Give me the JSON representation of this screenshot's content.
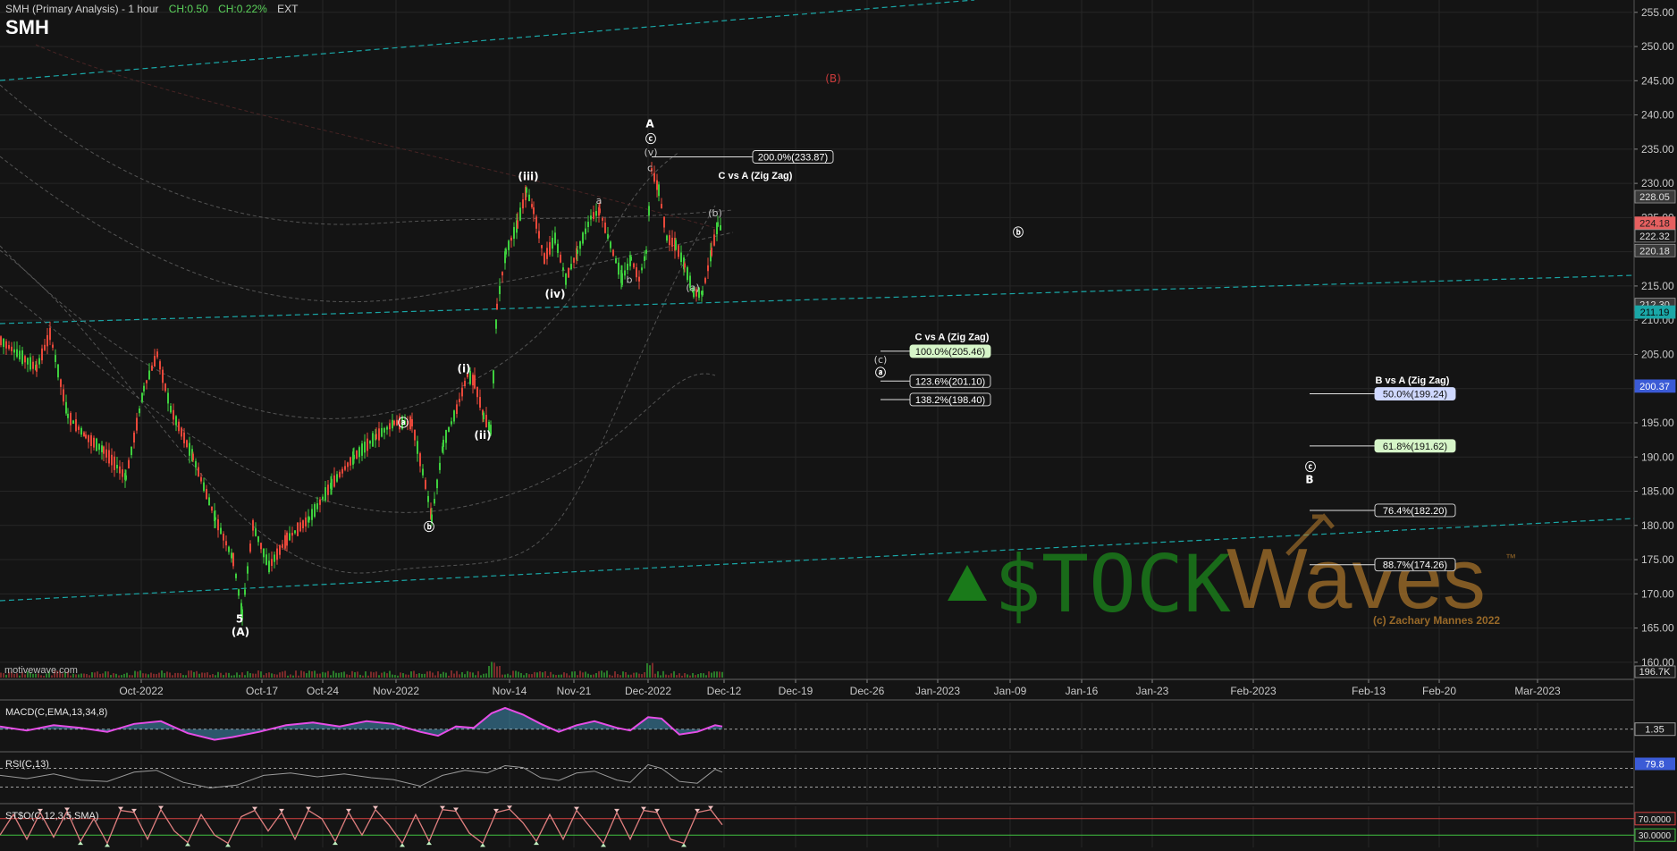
{
  "header": {
    "title": "SMH (Primary Analysis) - 1 hour",
    "change_abs": "CH:0.50",
    "change_pct": "CH:0.22%",
    "ext": "EXT",
    "symbol": "SMH"
  },
  "footer_text": "motivewave.com",
  "colors": {
    "background": "#141414",
    "grid": "#262626",
    "up": "#3ecf3e",
    "down": "#e8483a",
    "channel": "#1aa7a7",
    "macd": "#e64de6",
    "macd_hist": "#4aa9d8",
    "brand_green": "#1a7a1a",
    "brand_gold": "#b0782c"
  },
  "chart_data": {
    "type": "line",
    "price_axis": {
      "ticks": [
        160,
        165,
        170,
        175,
        180,
        185,
        190,
        195,
        200,
        205,
        210,
        215,
        220,
        225,
        230,
        235,
        240,
        245,
        250,
        255
      ],
      "ylim": [
        157.5,
        256.8
      ]
    },
    "date_axis": {
      "ticks": [
        "Oct-2022",
        "Oct-17",
        "Oct-24",
        "Nov-2022",
        "Nov-14",
        "Nov-21",
        "Dec-2022",
        "Dec-12",
        "Dec-19",
        "Dec-26",
        "Jan-2023",
        "Jan-09",
        "Jan-16",
        "Jan-23",
        "Feb-2023",
        "Feb-13",
        "Feb-20",
        "Mar-2023"
      ]
    },
    "price_tags": [
      {
        "value": "228.05",
        "price": 228.05,
        "style": "grey"
      },
      {
        "value": "224.18",
        "price": 224.18,
        "style": "red"
      },
      {
        "value": "222.32",
        "price": 222.32,
        "style": "dark"
      },
      {
        "value": "220.18",
        "price": 220.18,
        "style": "grey"
      },
      {
        "value": "212.30",
        "price": 212.3,
        "style": "grey"
      },
      {
        "value": "211.19",
        "price": 211.19,
        "style": "teal"
      },
      {
        "value": "200.37",
        "price": 200.37,
        "style": "blue"
      }
    ],
    "volume_tag": "196.7K",
    "price_series": [
      [
        0,
        207
      ],
      [
        40,
        203
      ],
      [
        55,
        208
      ],
      [
        75,
        196
      ],
      [
        95,
        193
      ],
      [
        115,
        191
      ],
      [
        140,
        187
      ],
      [
        160,
        200
      ],
      [
        175,
        205
      ],
      [
        190,
        197
      ],
      [
        215,
        190
      ],
      [
        240,
        181
      ],
      [
        260,
        175
      ],
      [
        270,
        167
      ],
      [
        282,
        180
      ],
      [
        300,
        174
      ],
      [
        320,
        178
      ],
      [
        345,
        181
      ],
      [
        370,
        186
      ],
      [
        395,
        190
      ],
      [
        420,
        193
      ],
      [
        440,
        195
      ],
      [
        460,
        195
      ],
      [
        475,
        186
      ],
      [
        482,
        181
      ],
      [
        495,
        192
      ],
      [
        510,
        197
      ],
      [
        522,
        202
      ],
      [
        530,
        201
      ],
      [
        540,
        196
      ],
      [
        548,
        194
      ],
      [
        555,
        212
      ],
      [
        565,
        220
      ],
      [
        578,
        224
      ],
      [
        588,
        229
      ],
      [
        596,
        226
      ],
      [
        608,
        219
      ],
      [
        620,
        222
      ],
      [
        632,
        216
      ],
      [
        645,
        220
      ],
      [
        660,
        225
      ],
      [
        670,
        226
      ],
      [
        682,
        221
      ],
      [
        695,
        216
      ],
      [
        705,
        219
      ],
      [
        714,
        216
      ],
      [
        722,
        220
      ],
      [
        728,
        232
      ],
      [
        736,
        229
      ],
      [
        745,
        222
      ],
      [
        755,
        221
      ],
      [
        765,
        218
      ],
      [
        775,
        214
      ],
      [
        785,
        214
      ],
      [
        795,
        220
      ],
      [
        802,
        224
      ],
      [
        808,
        223
      ]
    ],
    "wave_labels": [
      {
        "text": "5",
        "x": 268,
        "price": 166.3,
        "type": "plain"
      },
      {
        "text": "(A)",
        "x": 269,
        "price": 164.4,
        "type": "plain"
      },
      {
        "text": "ⓑ",
        "x": 480,
        "price": 179.8,
        "type": "plain"
      },
      {
        "text": "ⓐ",
        "x": 451,
        "price": 195.0,
        "type": "plain"
      },
      {
        "text": "(i)",
        "x": 519,
        "price": 202.9,
        "type": "plain"
      },
      {
        "text": "(ii)",
        "x": 540,
        "price": 193.2,
        "type": "plain"
      },
      {
        "text": "(iii)",
        "x": 591,
        "price": 231.0,
        "type": "plain"
      },
      {
        "text": "(iv)",
        "x": 621,
        "price": 213.8,
        "type": "plain"
      },
      {
        "text": "a",
        "x": 670,
        "price": 227.5,
        "type": "small"
      },
      {
        "text": "b",
        "x": 704,
        "price": 216.0,
        "type": "small"
      },
      {
        "text": "c",
        "x": 727,
        "price": 232.3,
        "type": "small"
      },
      {
        "text": "A",
        "x": 727,
        "price": 238.7,
        "type": "plain"
      },
      {
        "text": "ⓒ",
        "x": 728,
        "price": 236.5,
        "type": "plain"
      },
      {
        "text": "(v)",
        "x": 728,
        "price": 234.6,
        "type": "small"
      },
      {
        "text": "(a)",
        "x": 775,
        "price": 214.8,
        "type": "small"
      },
      {
        "text": "(b)",
        "x": 800,
        "price": 225.7,
        "type": "small"
      },
      {
        "text": "ⓑ",
        "x": 1139,
        "price": 222.8,
        "type": "plain"
      },
      {
        "text": "(B)",
        "x": 932,
        "price": 245.3,
        "type": "red"
      },
      {
        "text": "(c)",
        "x": 985,
        "price": 204.3,
        "type": "small"
      },
      {
        "text": "ⓐ",
        "x": 985,
        "price": 202.3,
        "type": "plain"
      },
      {
        "text": "ⓒ",
        "x": 1466,
        "price": 188.5,
        "type": "plain"
      },
      {
        "text": "B",
        "x": 1465,
        "price": 186.7,
        "type": "plain"
      }
    ],
    "fib_sets": [
      {
        "title": "C vs A (Zig Zag)",
        "title_x": 845,
        "title_price": 231.2,
        "levels": [
          {
            "label": "200.0%(233.87)",
            "price": 233.87,
            "x1": 729,
            "x2": 842,
            "style": "outline"
          }
        ]
      },
      {
        "title": "C vs A (Zig Zag)",
        "title_x": 1065,
        "title_price": 207.6,
        "levels": [
          {
            "label": "100.0%(205.46)",
            "price": 205.46,
            "x1": 985,
            "x2": 1018,
            "style": "green"
          },
          {
            "label": "123.6%(201.10)",
            "price": 201.1,
            "x1": 985,
            "x2": 1018,
            "style": "outline"
          },
          {
            "label": "138.2%(198.40)",
            "price": 198.4,
            "x1": 985,
            "x2": 1018,
            "style": "outline"
          }
        ]
      },
      {
        "title": "B vs A (Zig Zag)",
        "title_x": 1580,
        "title_price": 201.3,
        "levels": [
          {
            "label": "50.0%(199.24)",
            "price": 199.24,
            "x1": 1465,
            "x2": 1538,
            "style": "blue"
          },
          {
            "label": "61.8%(191.62)",
            "price": 191.62,
            "x1": 1465,
            "x2": 1538,
            "style": "green"
          },
          {
            "label": "76.4%(182.20)",
            "price": 182.2,
            "x1": 1465,
            "x2": 1538,
            "style": "outline"
          },
          {
            "label": "88.7%(174.26)",
            "price": 174.26,
            "x1": 1465,
            "x2": 1538,
            "style": "outline"
          }
        ]
      }
    ],
    "watermark": {
      "word1": "$TOCK",
      "word2": "Waves",
      "tm": "™",
      "copyright": "(c) Zachary Mannes 2022"
    },
    "panels": [
      {
        "id": "macd",
        "label": "MACD(C,EMA,13,34,8)",
        "tag": "1.35",
        "series": [
          [
            0,
            0.2
          ],
          [
            30,
            -0.1
          ],
          [
            60,
            0.3
          ],
          [
            90,
            0.1
          ],
          [
            120,
            -0.2
          ],
          [
            150,
            0.4
          ],
          [
            180,
            0.6
          ],
          [
            210,
            -0.3
          ],
          [
            240,
            -0.8
          ],
          [
            260,
            -0.6
          ],
          [
            290,
            -0.2
          ],
          [
            320,
            0.3
          ],
          [
            350,
            0.5
          ],
          [
            380,
            0.2
          ],
          [
            410,
            0.6
          ],
          [
            440,
            0.4
          ],
          [
            470,
            -0.2
          ],
          [
            490,
            -0.5
          ],
          [
            510,
            0.2
          ],
          [
            530,
            0.1
          ],
          [
            550,
            1.2
          ],
          [
            565,
            1.6
          ],
          [
            585,
            1.1
          ],
          [
            605,
            0.4
          ],
          [
            625,
            -0.2
          ],
          [
            645,
            0.3
          ],
          [
            665,
            0.6
          ],
          [
            690,
            0.1
          ],
          [
            705,
            -0.1
          ],
          [
            725,
            0.9
          ],
          [
            740,
            0.8
          ],
          [
            760,
            -0.4
          ],
          [
            780,
            -0.2
          ],
          [
            800,
            0.3
          ],
          [
            808,
            0.2
          ]
        ],
        "ylim": [
          -1.5,
          2.0
        ],
        "zero": 0
      },
      {
        "id": "rsi",
        "label": "RSI(C,13)",
        "tag": "79.8",
        "series": [
          [
            0,
            55
          ],
          [
            30,
            48
          ],
          [
            60,
            58
          ],
          [
            90,
            45
          ],
          [
            120,
            42
          ],
          [
            150,
            62
          ],
          [
            175,
            66
          ],
          [
            205,
            40
          ],
          [
            235,
            28
          ],
          [
            265,
            34
          ],
          [
            295,
            55
          ],
          [
            325,
            60
          ],
          [
            355,
            52
          ],
          [
            385,
            58
          ],
          [
            415,
            50
          ],
          [
            440,
            46
          ],
          [
            470,
            32
          ],
          [
            495,
            55
          ],
          [
            520,
            66
          ],
          [
            545,
            60
          ],
          [
            565,
            76
          ],
          [
            585,
            72
          ],
          [
            605,
            50
          ],
          [
            625,
            44
          ],
          [
            645,
            60
          ],
          [
            665,
            64
          ],
          [
            690,
            45
          ],
          [
            705,
            40
          ],
          [
            725,
            78
          ],
          [
            740,
            70
          ],
          [
            760,
            42
          ],
          [
            780,
            38
          ],
          [
            800,
            68
          ],
          [
            808,
            62
          ]
        ],
        "ylim": [
          0,
          100
        ],
        "levels": [
          70,
          30
        ]
      },
      {
        "id": "stoch",
        "label": "ST$O(C,12,3,5,SMA)",
        "tag_high": "70.0000",
        "tag_low": "30.0000",
        "series": [
          [
            0,
            30
          ],
          [
            15,
            80
          ],
          [
            30,
            20
          ],
          [
            45,
            85
          ],
          [
            60,
            25
          ],
          [
            75,
            88
          ],
          [
            90,
            15
          ],
          [
            105,
            70
          ],
          [
            120,
            10
          ],
          [
            135,
            90
          ],
          [
            150,
            85
          ],
          [
            165,
            20
          ],
          [
            180,
            92
          ],
          [
            195,
            40
          ],
          [
            210,
            12
          ],
          [
            225,
            80
          ],
          [
            240,
            30
          ],
          [
            255,
            10
          ],
          [
            270,
            75
          ],
          [
            285,
            90
          ],
          [
            300,
            40
          ],
          [
            315,
            85
          ],
          [
            330,
            20
          ],
          [
            345,
            90
          ],
          [
            360,
            70
          ],
          [
            375,
            15
          ],
          [
            390,
            85
          ],
          [
            405,
            30
          ],
          [
            420,
            92
          ],
          [
            435,
            55
          ],
          [
            450,
            10
          ],
          [
            465,
            80
          ],
          [
            480,
            15
          ],
          [
            495,
            92
          ],
          [
            510,
            88
          ],
          [
            525,
            35
          ],
          [
            540,
            10
          ],
          [
            555,
            85
          ],
          [
            570,
            93
          ],
          [
            585,
            60
          ],
          [
            600,
            15
          ],
          [
            615,
            80
          ],
          [
            630,
            20
          ],
          [
            645,
            90
          ],
          [
            660,
            50
          ],
          [
            675,
            10
          ],
          [
            690,
            85
          ],
          [
            705,
            20
          ],
          [
            720,
            90
          ],
          [
            735,
            85
          ],
          [
            750,
            20
          ],
          [
            765,
            10
          ],
          [
            780,
            85
          ],
          [
            795,
            92
          ],
          [
            808,
            55
          ]
        ],
        "ylim": [
          0,
          100
        ],
        "levels": [
          70,
          30
        ]
      }
    ]
  }
}
